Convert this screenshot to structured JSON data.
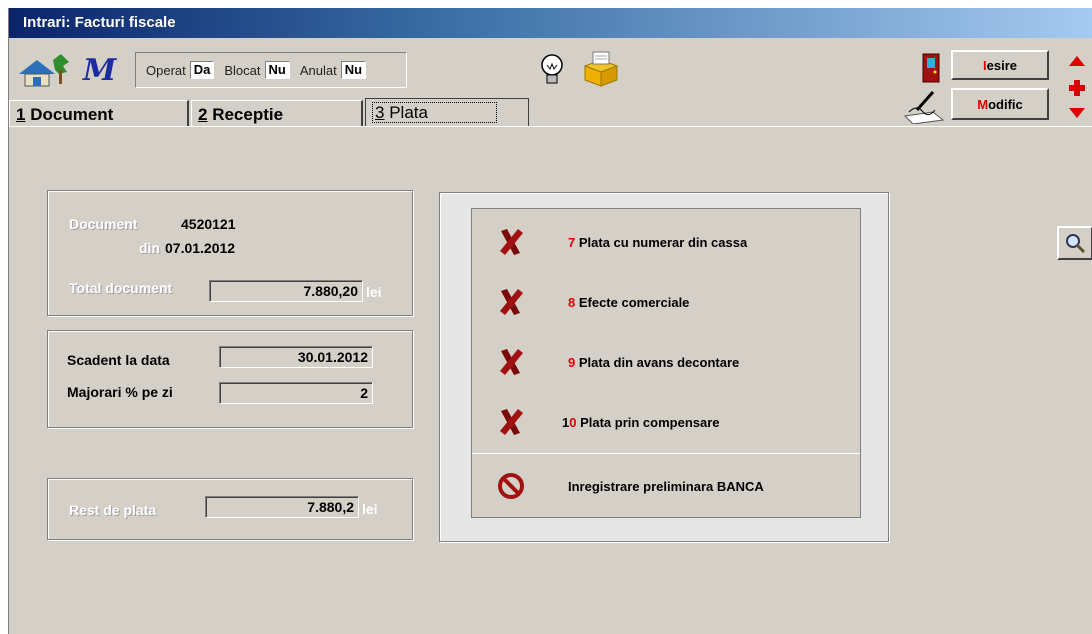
{
  "window": {
    "title": "Intrari: Facturi fiscale"
  },
  "status": {
    "operat_label": "Operat",
    "operat_value": "Da",
    "blocat_label": "Blocat",
    "blocat_value": "Nu",
    "anulat_label": "Anulat",
    "anulat_value": "Nu"
  },
  "toolbar": {
    "iesire_first": "I",
    "iesire_rest": "esire",
    "modific_first": "M",
    "modific_rest": "odific",
    "icons": [
      "home-icon",
      "m-logo-icon",
      "lightbulb-icon",
      "print-box-icon",
      "exit-door-icon",
      "pen-edit-icon",
      "arrow-up-icon",
      "plus-icon",
      "arrow-down-icon",
      "magnifier-icon"
    ]
  },
  "tabs": [
    {
      "num": "1",
      "label": "Document"
    },
    {
      "num": "2",
      "label": "Receptie"
    },
    {
      "num": "3",
      "label": "Plata"
    }
  ],
  "document": {
    "label": "Document",
    "number": "4520121",
    "din_label": "din",
    "date": "07.01.2012",
    "total_label": "Total document",
    "total_value": "7.880,20",
    "currency": "lei"
  },
  "scadent": {
    "label": "Scadent la data",
    "value": "30.01.2012",
    "majorari_label": "Majorari  % pe zi",
    "majorari_value": "2"
  },
  "rest": {
    "label": "Rest de plata",
    "value": "7.880,2",
    "currency": "lei"
  },
  "payments": [
    {
      "num": "7",
      "label": " Plata cu numerar din cassa",
      "icon": "red-x-icon"
    },
    {
      "num": "8",
      "label": " Efecte comerciale",
      "icon": "red-x-icon"
    },
    {
      "num": "9",
      "label": " Plata din avans decontare",
      "icon": "red-x-icon"
    },
    {
      "num": "1",
      "num2": "0",
      "label": " Plata prin compensare",
      "icon": "red-x-icon"
    },
    {
      "label": "Inregistrare preliminara BANCA",
      "icon": "prohibited-icon"
    }
  ]
}
